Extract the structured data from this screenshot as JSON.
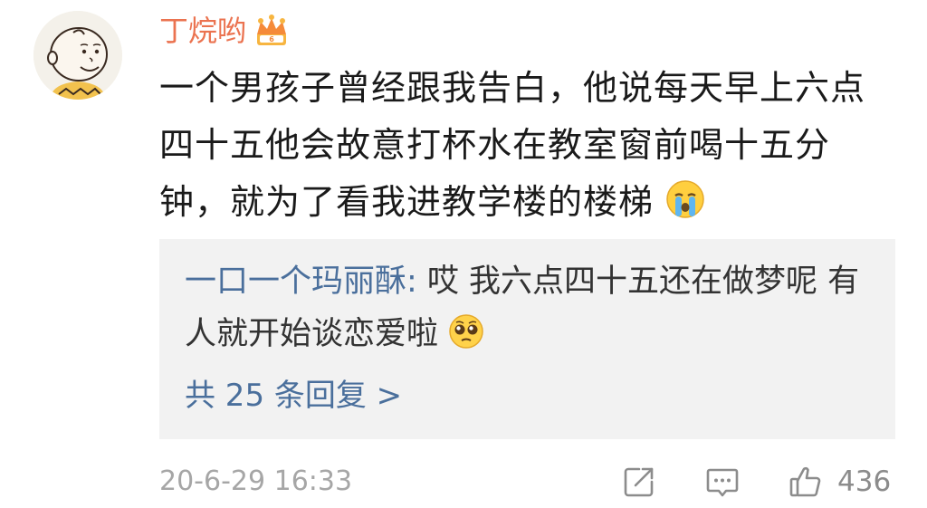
{
  "comment": {
    "username": "丁烷哟",
    "badge_icon": "crown-icon",
    "text": "一个男孩子曾经跟我告白，他说每天早上六点四十五他会故意打杯水在教室窗前喝十五分钟，就为了看我进教学楼的楼梯",
    "emoji": "crying-face-emoji",
    "timestamp": "20-6-29 16:33",
    "likes": "436"
  },
  "reply": {
    "author": "一口一个玛丽酥:",
    "text": " 哎 我六点四十五还在做梦呢 有人就开始谈恋爱啦",
    "emoji": "pleading-face-emoji",
    "more_label": "共 25 条回复 >"
  },
  "colors": {
    "username": "#eb7350",
    "reply_author": "#4a6f9c",
    "reply_bg": "#f2f2f2",
    "meta_gray": "#a6a6a6"
  }
}
